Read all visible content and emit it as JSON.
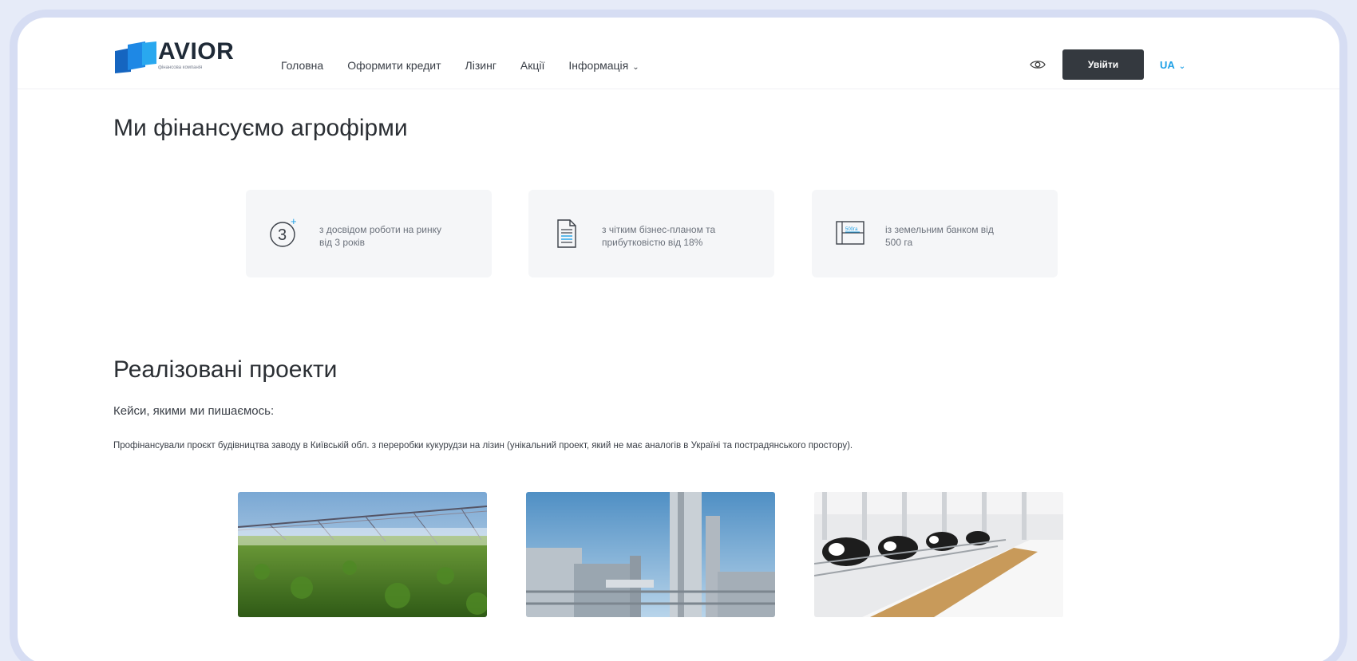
{
  "brand": {
    "name": "AVIOR",
    "tagline": "фінансова компанія",
    "colors": {
      "primary": "#1565c0",
      "secondary": "#1ea0e6",
      "dark": "#34393f"
    }
  },
  "nav": {
    "items": [
      {
        "label": "Головна"
      },
      {
        "label": "Оформити кредит"
      },
      {
        "label": "Лізинг"
      },
      {
        "label": "Акції"
      },
      {
        "label": "Інформація"
      }
    ]
  },
  "header": {
    "accessibility_icon": "eye-icon",
    "login_label": "Увійти",
    "lang_label": "UA"
  },
  "section_finance": {
    "title": "Ми фінансуємо агрофірми",
    "features": [
      {
        "icon": "three-plus-years-icon",
        "icon_text": "3",
        "line1": "з досвідом роботи на ринку",
        "line2": "від 3 років"
      },
      {
        "icon": "business-plan-document-icon",
        "line1": "з чітким бізнес-планом та",
        "line2": "прибутковістю від 18%"
      },
      {
        "icon": "land-bank-icon",
        "icon_text": "500га",
        "line1": "із земельним банком від",
        "line2": "500 га"
      }
    ]
  },
  "section_projects": {
    "title": "Реалізовані проекти",
    "subtitle": "Кейси, якими ми пишаємось:",
    "description": "Профінансували проєкт будівництва заводу в Київській обл. з переробки кукурудзи на лізин (унікальний проект, який не має аналогів в Україні та пострадянського простору).",
    "photos": [
      {
        "name": "irrigation-field-photo"
      },
      {
        "name": "factory-photo"
      },
      {
        "name": "dairy-farm-photo"
      }
    ]
  }
}
